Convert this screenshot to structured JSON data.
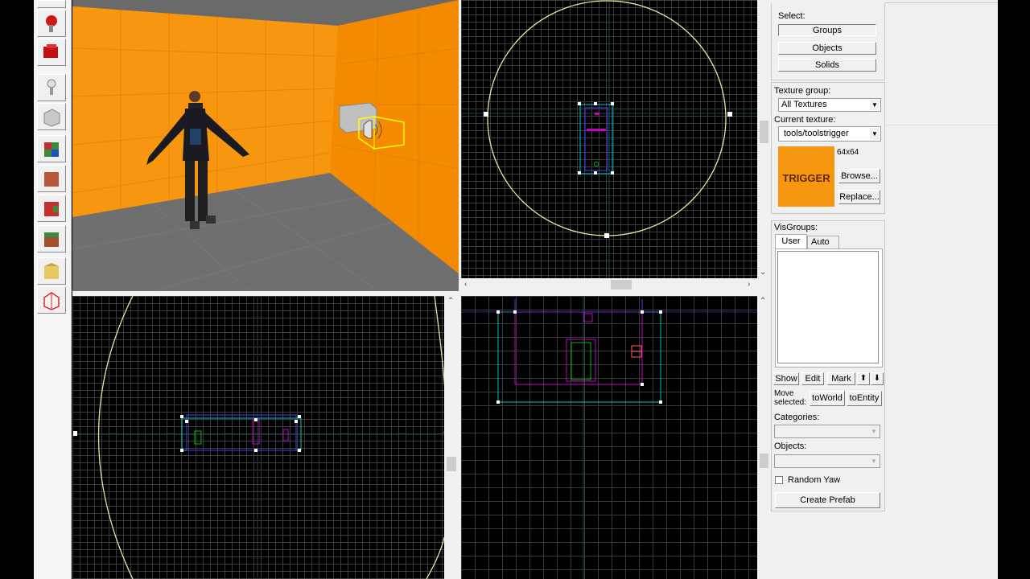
{
  "toolbar": {
    "tools": [
      "pointer-tool",
      "magnify-tool",
      "camera-tool",
      "entity-tool",
      "block-tool",
      "texture-tool",
      "apply-texture-tool",
      "decal-tool",
      "overlay-tool",
      "clip-tool",
      "vertex-tool"
    ]
  },
  "panel": {
    "select_label": "Select:",
    "groups": "Groups",
    "objects": "Objects",
    "solids": "Solids",
    "texture_group_label": "Texture group:",
    "texture_group_value": "All Textures",
    "current_texture_label": "Current texture:",
    "current_texture_value": "tools/toolstrigger",
    "texture_size": "64x64",
    "texture_preview_text": "TRIGGER",
    "browse": "Browse...",
    "replace": "Replace...",
    "visgroups_label": "VisGroups:",
    "tab_user": "User",
    "tab_auto": "Auto",
    "show": "Show",
    "edit": "Edit",
    "mark": "Mark",
    "up": "⬆",
    "down": "⬇",
    "move_selected_label_1": "Move",
    "move_selected_label_2": "selected:",
    "to_world": "toWorld",
    "to_entity": "toEntity",
    "categories_label": "Categories:",
    "objects_label": "Objects:",
    "random_yaw": "Random Yaw",
    "create_prefab": "Create Prefab"
  },
  "colors": {
    "orange_wall": "#f7960f",
    "floor": "#6e6e6e",
    "selection_yellow": "#ffff00",
    "brush_cyan": "#00c8c8",
    "brush_magenta": "#c800c8"
  }
}
